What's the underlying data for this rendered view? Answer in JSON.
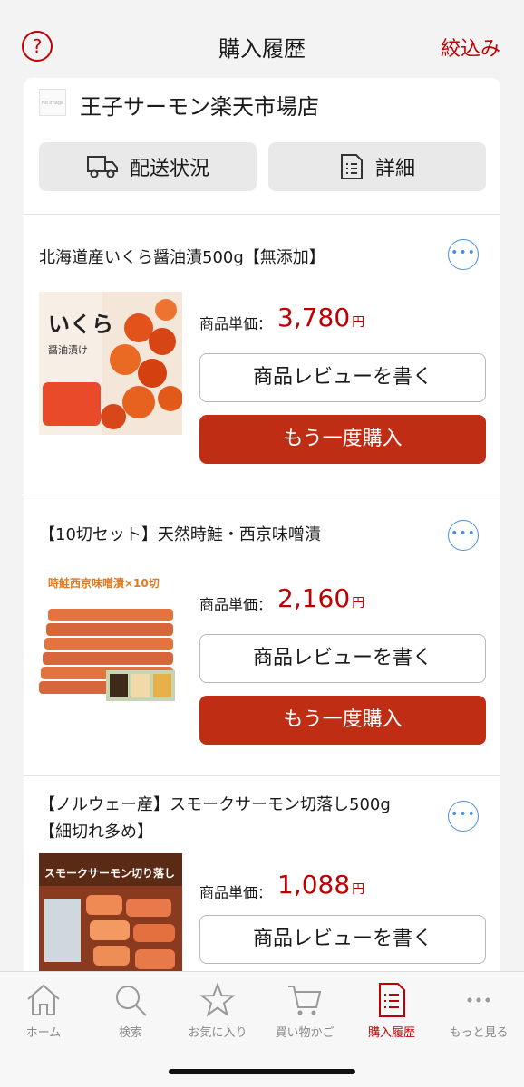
{
  "header": {
    "help_glyph": "?",
    "title": "購入履歴",
    "filter_label": "絞込み"
  },
  "shop": {
    "logo_text": "No Image",
    "name": "王子サーモン楽天市場店",
    "delivery_label": "配送状況",
    "detail_label": "詳細"
  },
  "items": [
    {
      "title": "北海道産いくら醤油漬500g【無添加】",
      "price_label": "商品単価：",
      "price": "3,780",
      "currency": "円",
      "review_label": "商品レビューを書く",
      "rebuy_label": "もう一度購入",
      "image_text": "いくら",
      "image_subtext": "醤油漬け"
    },
    {
      "title": "【10切セット】天然時鮭・西京味噌漬",
      "price_label": "商品単価：",
      "price": "2,160",
      "currency": "円",
      "review_label": "商品レビューを書く",
      "rebuy_label": "もう一度購入",
      "image_text": "時鮭西京味噌漬×10切"
    },
    {
      "title": "【ノルウェー産】スモークサーモン切落し500g【細切れ多め】",
      "price_label": "商品単価：",
      "price": "1,088",
      "currency": "円",
      "review_label": "商品レビューを書く",
      "image_text": "スモークサーモン切り落し"
    }
  ],
  "more_glyph": "•••",
  "tabbar": {
    "tabs": [
      {
        "label": "ホーム",
        "icon": "home-icon"
      },
      {
        "label": "検索",
        "icon": "search-icon"
      },
      {
        "label": "お気に入り",
        "icon": "star-icon"
      },
      {
        "label": "買い物かご",
        "icon": "cart-icon"
      },
      {
        "label": "購入履歴",
        "icon": "receipt-icon",
        "active": true
      },
      {
        "label": "もっと見る",
        "icon": "more-icon"
      }
    ]
  },
  "colors": {
    "accent": "#bf0000",
    "rebuy": "#bf2e14",
    "link_blue": "#4a90d9"
  }
}
